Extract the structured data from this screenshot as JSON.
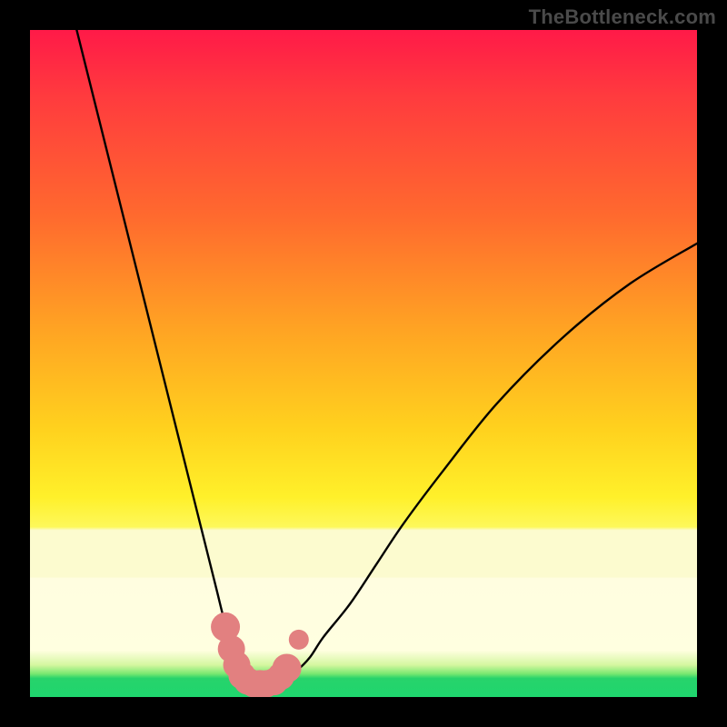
{
  "watermark": "TheBottleneck.com",
  "colors": {
    "frame": "#000000",
    "curve": "#000000",
    "marker_fill": "#e28080",
    "marker_stroke": "#c86a6a",
    "gradient_top": "#ff1a48",
    "gradient_mid": "#fff02a",
    "gradient_band": "#fcfbcf",
    "gradient_bottom": "#1fd66e"
  },
  "chart_data": {
    "type": "line",
    "title": "",
    "xlabel": "",
    "ylabel": "",
    "xlim": [
      0,
      100
    ],
    "ylim": [
      0,
      100
    ],
    "series": [
      {
        "name": "bottleneck-curve",
        "x": [
          7,
          10,
          14,
          18,
          22,
          24,
          26,
          28,
          29,
          30,
          31,
          32,
          33,
          34,
          35,
          36,
          37,
          38,
          40,
          42,
          44,
          48,
          52,
          56,
          62,
          70,
          80,
          90,
          100
        ],
        "y": [
          100,
          88,
          72,
          56,
          40,
          32,
          24,
          16,
          12,
          9,
          6,
          4,
          3,
          2,
          2,
          2,
          2,
          3,
          4,
          6,
          9,
          14,
          20,
          26,
          34,
          44,
          54,
          62,
          68
        ]
      }
    ],
    "markers": {
      "name": "highlighted-range",
      "x": [
        29.3,
        30.2,
        31.0,
        31.8,
        32.6,
        33.5,
        34.5,
        35.5,
        36.6,
        37.6,
        38.5,
        40.3
      ],
      "y": [
        10.5,
        7.2,
        4.8,
        3.2,
        2.4,
        2.0,
        2.0,
        2.0,
        2.3,
        3.1,
        4.3,
        8.6
      ],
      "r": [
        16,
        15,
        15,
        15,
        15,
        15,
        15,
        15,
        15,
        15,
        16,
        11
      ]
    },
    "annotations": []
  }
}
